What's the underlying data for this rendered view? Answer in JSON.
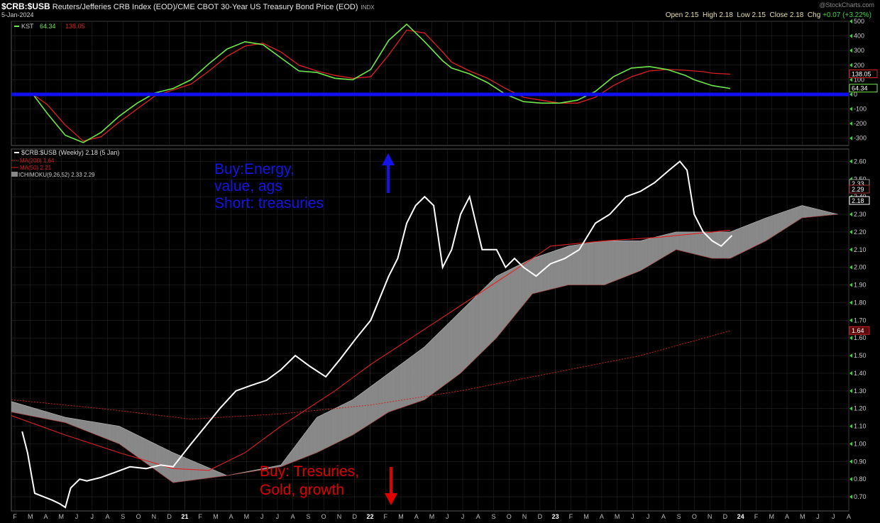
{
  "header": {
    "symbol": "$CRB:$USB",
    "description": "Reuters/Jefferies CRB Index (EOD)/CME CBOT 30-Year US Treasury Bond Price (EOD)",
    "exchange": "INDX",
    "date": "5-Jan-2024",
    "watermark": "@StockCharts.com",
    "open_label": "Open",
    "open": "2.15",
    "high_label": "High",
    "high": "2.18",
    "low_label": "Low",
    "low": "2.15",
    "close_label": "Close",
    "close": "2.18",
    "chg_label": "Chg",
    "chg": "+0.07 (+3.22%)"
  },
  "annotations": {
    "buy_energy": [
      "Buy:Energy,",
      "value, ags",
      "Short: treasuries"
    ],
    "buy_treasuries": [
      "Buy: Tresuries,",
      "Gold, growth"
    ]
  },
  "colors": {
    "background": "#000000",
    "price_line": "#ffffff",
    "kst_line": "#6ee84a",
    "kst_signal": "#e02020",
    "zero_line": "#1010ee",
    "ma200": "#d02020",
    "ma50": "#e02020",
    "cloud_bull": "#888888",
    "cloud_bear": "#6a0f0f",
    "annotation_blue": "#1414e6",
    "annotation_red": "#e00000",
    "grid": "#252525"
  },
  "chart_data": [
    {
      "type": "line",
      "panel": "KST indicator",
      "legend": [
        {
          "name": "KST",
          "value": "64.34",
          "color": "#6ee84a"
        },
        {
          "name": "",
          "value": "138.05",
          "color": "#e02020"
        }
      ],
      "ylim": [
        -350,
        500
      ],
      "y_ticks": [
        "500",
        "400",
        "300",
        "200",
        "100",
        "0",
        "-100",
        "-200",
        "-300"
      ],
      "last_value_tags": [
        "138.05",
        "64.34"
      ],
      "x": [
        2020.12,
        2020.2,
        2020.3,
        2020.4,
        2020.5,
        2020.6,
        2020.7,
        2020.8,
        2020.9,
        2021.0,
        2021.1,
        2021.2,
        2021.3,
        2021.4,
        2021.5,
        2021.6,
        2021.7,
        2021.8,
        2021.9,
        2022.0,
        2022.1,
        2022.2,
        2022.3,
        2022.4,
        2022.45,
        2022.55,
        2022.65,
        2022.75,
        2022.85,
        2022.95,
        2023.05,
        2023.15,
        2023.25,
        2023.35,
        2023.45,
        2023.55,
        2023.65,
        2023.75,
        2023.8,
        2023.85,
        2023.9,
        2024.0
      ],
      "series": [
        {
          "name": "KST",
          "values": [
            0,
            -130,
            -280,
            -330,
            -260,
            -150,
            -60,
            10,
            40,
            100,
            210,
            310,
            360,
            340,
            250,
            160,
            150,
            110,
            100,
            170,
            370,
            480,
            360,
            230,
            180,
            140,
            80,
            0,
            -50,
            -60,
            -60,
            -40,
            20,
            120,
            180,
            190,
            170,
            130,
            100,
            80,
            60,
            40
          ]
        },
        {
          "name": "",
          "values": [
            0,
            -70,
            -210,
            -320,
            -290,
            -190,
            -100,
            -10,
            30,
            70,
            160,
            260,
            330,
            350,
            290,
            200,
            160,
            130,
            110,
            120,
            270,
            440,
            420,
            290,
            220,
            160,
            110,
            40,
            -20,
            -40,
            -60,
            -60,
            -20,
            60,
            120,
            160,
            170,
            165,
            160,
            155,
            145,
            138
          ]
        }
      ],
      "reference_line": 0
    },
    {
      "type": "line",
      "panel": "price",
      "legend": [
        {
          "name": "$CRB:$USB (Weekly) 2.18 (5 Jan)",
          "color": "#ffffff"
        },
        {
          "name": "MA(200) 1.64",
          "color": "#d02020"
        },
        {
          "name": "MA(50) 2.21",
          "color": "#e02020"
        },
        {
          "name": "ICHIMOKU(9,26,52) 2.33 2.29",
          "color": "#888888"
        }
      ],
      "ylim": [
        0.62,
        2.67
      ],
      "y_ticks": [
        "2.60",
        "2.50",
        "2.40",
        "2.30",
        "2.20",
        "2.10",
        "2.00",
        "1.90",
        "1.80",
        "1.70",
        "1.60",
        "1.50",
        "1.40",
        "1.30",
        "1.20",
        "1.10",
        "1.00",
        "0.90",
        "0.80",
        "0.70"
      ],
      "last_value_tags": [
        "2.33",
        "2.29",
        "2.18",
        "1.64"
      ],
      "x_ticks": [
        "F",
        "M",
        "A",
        "M",
        "J",
        "J",
        "A",
        "S",
        "O",
        "N",
        "D",
        "21",
        "F",
        "M",
        "A",
        "M",
        "J",
        "J",
        "A",
        "S",
        "O",
        "N",
        "D",
        "22",
        "F",
        "M",
        "A",
        "M",
        "J",
        "J",
        "A",
        "S",
        "O",
        "N",
        "D",
        "23",
        "F",
        "M",
        "A",
        "M",
        "J",
        "J",
        "A",
        "S",
        "O",
        "N",
        "D",
        "24",
        "F",
        "M",
        "A",
        "M",
        "J",
        "J",
        "A"
      ],
      "series": [
        {
          "name": "$CRB:$USB",
          "x": [
            2020.06,
            2020.09,
            2020.13,
            2020.18,
            2020.23,
            2020.27,
            2020.3,
            2020.33,
            2020.38,
            2020.42,
            2020.5,
            2020.58,
            2020.66,
            2020.75,
            2020.83,
            2020.9,
            2021.0,
            2021.08,
            2021.16,
            2021.25,
            2021.33,
            2021.42,
            2021.5,
            2021.58,
            2021.66,
            2021.75,
            2021.83,
            2021.92,
            2022.0,
            2022.1,
            2022.15,
            2022.2,
            2022.25,
            2022.3,
            2022.35,
            2022.4,
            2022.45,
            2022.5,
            2022.55,
            2022.62,
            2022.7,
            2022.75,
            2022.8,
            2022.85,
            2022.92,
            2023.0,
            2023.08,
            2023.16,
            2023.25,
            2023.33,
            2023.42,
            2023.5,
            2023.58,
            2023.66,
            2023.72,
            2023.76,
            2023.8,
            2023.85,
            2023.9,
            2023.95,
            2024.01
          ],
          "values": [
            1.07,
            0.95,
            0.72,
            0.7,
            0.68,
            0.66,
            0.64,
            0.75,
            0.8,
            0.79,
            0.81,
            0.84,
            0.87,
            0.86,
            0.88,
            0.87,
            1.0,
            1.1,
            1.2,
            1.3,
            1.33,
            1.36,
            1.42,
            1.5,
            1.44,
            1.38,
            1.48,
            1.6,
            1.7,
            1.95,
            2.05,
            2.25,
            2.35,
            2.4,
            2.35,
            2.0,
            2.1,
            2.3,
            2.4,
            2.1,
            2.1,
            2.0,
            2.05,
            2.0,
            1.95,
            2.02,
            2.05,
            2.1,
            2.25,
            2.3,
            2.4,
            2.43,
            2.48,
            2.55,
            2.6,
            2.55,
            2.3,
            2.2,
            2.15,
            2.12,
            2.18
          ]
        },
        {
          "name": "MA(200)",
          "x": [
            2020.0,
            2020.5,
            2021.0,
            2021.5,
            2022.0,
            2022.5,
            2023.0,
            2023.5,
            2024.0
          ],
          "values": [
            1.25,
            1.2,
            1.14,
            1.17,
            1.22,
            1.3,
            1.4,
            1.5,
            1.64
          ]
        },
        {
          "name": "MA(50)",
          "x": [
            2020.0,
            2020.3,
            2020.6,
            2020.9,
            2021.1,
            2021.3,
            2021.5,
            2021.8,
            2022.0,
            2022.3,
            2022.6,
            2022.9,
            2023.0,
            2023.3,
            2023.6,
            2023.9,
            2024.0
          ],
          "values": [
            1.16,
            1.05,
            0.95,
            0.86,
            0.85,
            0.95,
            1.1,
            1.3,
            1.45,
            1.65,
            1.85,
            2.05,
            2.12,
            2.15,
            2.17,
            2.2,
            2.21
          ]
        },
        {
          "name": "ICHIMOKU span A",
          "x": [
            2020.0,
            2020.3,
            2020.6,
            2020.9,
            2021.2,
            2021.5,
            2021.7,
            2021.9,
            2022.1,
            2022.3,
            2022.5,
            2022.7,
            2022.9,
            2023.1,
            2023.3,
            2023.5,
            2023.7,
            2023.9,
            2024.0,
            2024.2,
            2024.4,
            2024.6
          ],
          "values": [
            1.24,
            1.15,
            1.1,
            0.95,
            0.82,
            0.88,
            1.15,
            1.25,
            1.4,
            1.55,
            1.75,
            1.95,
            2.05,
            2.12,
            2.15,
            2.15,
            2.2,
            2.2,
            2.2,
            2.28,
            2.35,
            2.3
          ]
        },
        {
          "name": "ICHIMOKU span B",
          "x": [
            2020.0,
            2020.3,
            2020.6,
            2020.9,
            2021.2,
            2021.5,
            2021.7,
            2021.9,
            2022.1,
            2022.3,
            2022.5,
            2022.7,
            2022.9,
            2023.1,
            2023.3,
            2023.5,
            2023.7,
            2023.9,
            2024.0,
            2024.2,
            2024.4,
            2024.6
          ],
          "values": [
            1.18,
            1.12,
            1.0,
            0.78,
            0.82,
            0.87,
            0.95,
            1.05,
            1.18,
            1.25,
            1.4,
            1.6,
            1.85,
            1.9,
            1.9,
            1.98,
            2.1,
            2.05,
            2.05,
            2.15,
            2.28,
            2.3
          ]
        }
      ]
    }
  ]
}
